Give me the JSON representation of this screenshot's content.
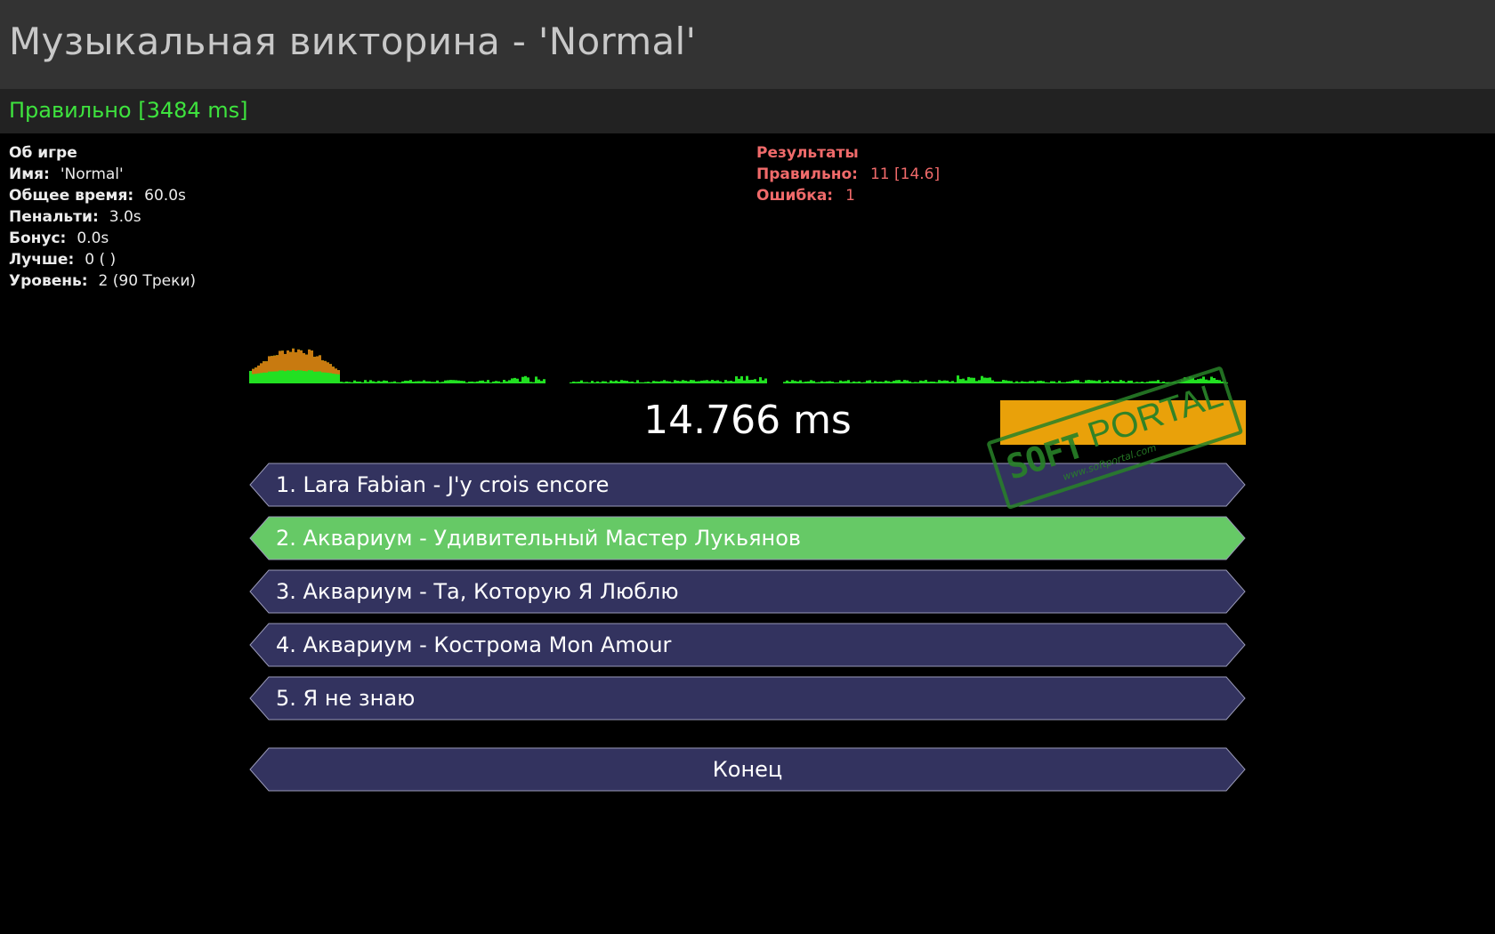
{
  "window": {
    "title": "Музыкальная викторина - 'Normal'"
  },
  "status": {
    "text": "Правильно [3484 ms]",
    "color": "#3ee33e"
  },
  "about": {
    "heading": "Об игре",
    "rows": [
      {
        "key": "Имя:",
        "value": "'Normal'"
      },
      {
        "key": "Общее время:",
        "value": "60.0s"
      },
      {
        "key": "Пенальти:",
        "value": "3.0s"
      },
      {
        "key": "Бонус:",
        "value": "0.0s"
      },
      {
        "key": "Лучше:",
        "value": "0 (  )"
      },
      {
        "key": "Уровень:",
        "value": "2 (90 Треки)"
      }
    ]
  },
  "results": {
    "heading": "Результаты",
    "rows": [
      {
        "key": "Правильно:",
        "value": "11 [14.6]"
      },
      {
        "key": "Ошибка:",
        "value": "1"
      }
    ]
  },
  "timer": {
    "text": "14.766 ms"
  },
  "answers": [
    {
      "label": "1. Lara Fabian - J'y crois encore",
      "state": "normal"
    },
    {
      "label": "2. Аквариум - Удивительный Мастер Лукьянов",
      "state": "correct"
    },
    {
      "label": "3. Аквариум - Та, Которую Я Люблю",
      "state": "normal"
    },
    {
      "label": "4. Аквариум - Кострома Mon Amour",
      "state": "normal"
    },
    {
      "label": "5. Я не знаю",
      "state": "normal"
    }
  ],
  "end_button": {
    "label": "Конец"
  },
  "watermark": {
    "brand_soft": "SOFT",
    "brand_portal": "PORTAL",
    "url": "www.softportal.com"
  },
  "colors": {
    "answer_fill": "#33335f",
    "answer_correct": "#66c966",
    "answer_border": "#9a9ab8",
    "accent_orange": "#e9a10a",
    "wave_green": "#22e022",
    "wave_orange": "#c87a10"
  }
}
